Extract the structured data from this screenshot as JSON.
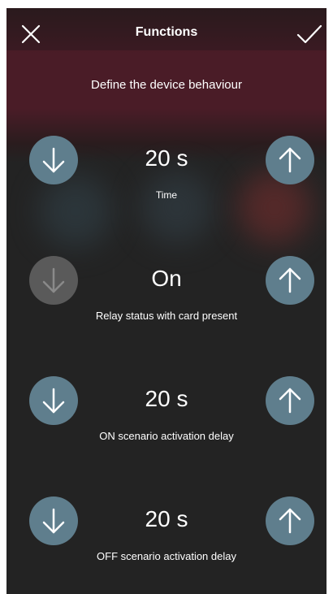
{
  "header": {
    "title": "Functions",
    "subtitle": "Define the device behaviour",
    "close_icon": "close-icon",
    "confirm_icon": "checkmark-icon"
  },
  "colors": {
    "header_accent": "#4a1c27",
    "background": "#232323",
    "button": "#5f7e8d",
    "button_disabled": "#5a5a5a"
  },
  "settings": [
    {
      "value": "20 s",
      "label": "Time",
      "decrease_enabled": true
    },
    {
      "value": "On",
      "label": "Relay status with card present",
      "decrease_enabled": false
    },
    {
      "value": "20 s",
      "label": "ON scenario activation delay",
      "decrease_enabled": true
    },
    {
      "value": "20 s",
      "label": "OFF scenario activation delay",
      "decrease_enabled": true
    }
  ]
}
